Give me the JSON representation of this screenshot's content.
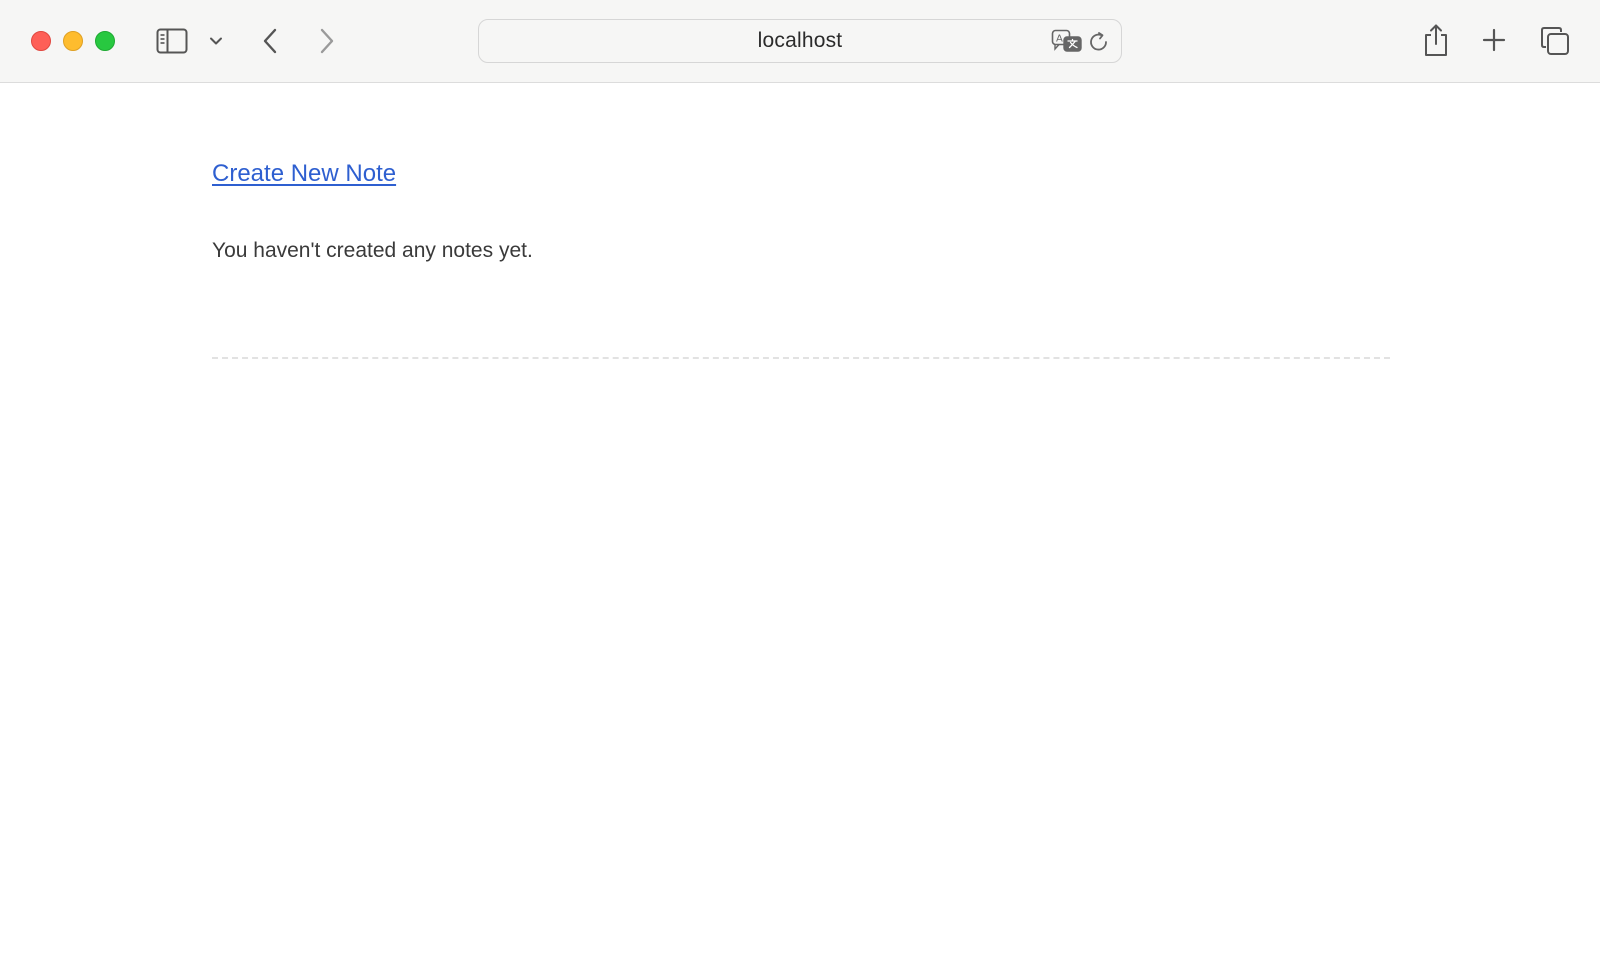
{
  "browser": {
    "address_bar": {
      "url_text": "localhost"
    },
    "icons": {
      "sidebar": "sidebar-icon",
      "tab_overview_chevron": "chevron-down-icon",
      "back": "chevron-left-icon",
      "forward": "chevron-right-icon",
      "translate": "translate-icon",
      "reload": "reload-icon",
      "share": "share-icon",
      "new_tab": "plus-icon",
      "tabs": "tabs-overview-icon"
    },
    "colors": {
      "close": "#fe5f57",
      "minimize": "#febc2e",
      "maximize": "#28c840"
    }
  },
  "page": {
    "create_link_label": "Create New Note",
    "empty_message": "You haven't created any notes yet.",
    "link_color": "#2e5fd0"
  }
}
